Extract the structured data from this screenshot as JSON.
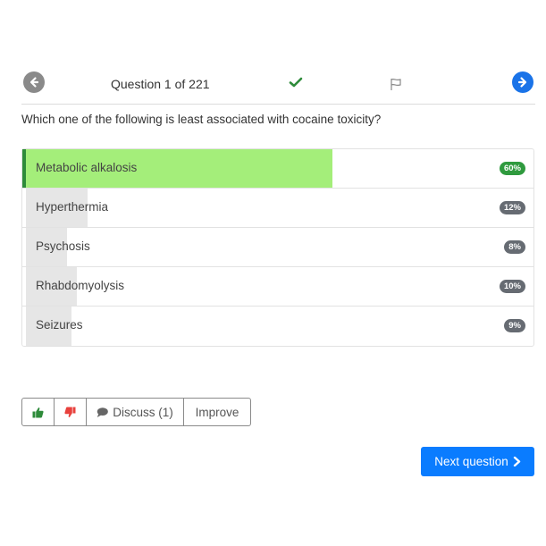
{
  "nav": {
    "counter": "Question 1 of 221"
  },
  "question": {
    "text": "Which one of the following is least associated with cocaine toxicity?"
  },
  "answers": [
    {
      "label": "Metabolic alkalosis",
      "percent_label": "60%",
      "share": 0.6,
      "correct": true
    },
    {
      "label": "Hyperthermia",
      "percent_label": "12%",
      "share": 0.12,
      "correct": false
    },
    {
      "label": "Psychosis",
      "percent_label": "8%",
      "share": 0.08,
      "correct": false
    },
    {
      "label": "Rhabdomyolysis",
      "percent_label": "10%",
      "share": 0.1,
      "correct": false
    },
    {
      "label": "Seizures",
      "percent_label": "9%",
      "share": 0.09,
      "correct": false
    }
  ],
  "actions": {
    "discuss_label": "Discuss (1)",
    "improve_label": "Improve"
  },
  "next": {
    "label": "Next question"
  },
  "colors": {
    "accent_blue": "#0a7cff",
    "correct_fill": "#a4ee7a",
    "correct_border": "#2e8b3a",
    "correct_badge": "#2f9a3e",
    "badge": "#666b72",
    "thumb_up": "#2e8b3a",
    "thumb_down": "#e8413d"
  },
  "icons": {
    "prev": "arrow-left-circle-icon",
    "next": "arrow-right-circle-icon",
    "answered": "check-icon",
    "flag": "flag-icon",
    "upvote": "thumbs-up-icon",
    "downvote": "thumbs-down-icon",
    "discuss": "comment-icon",
    "next_chevron": "chevron-right-icon"
  }
}
